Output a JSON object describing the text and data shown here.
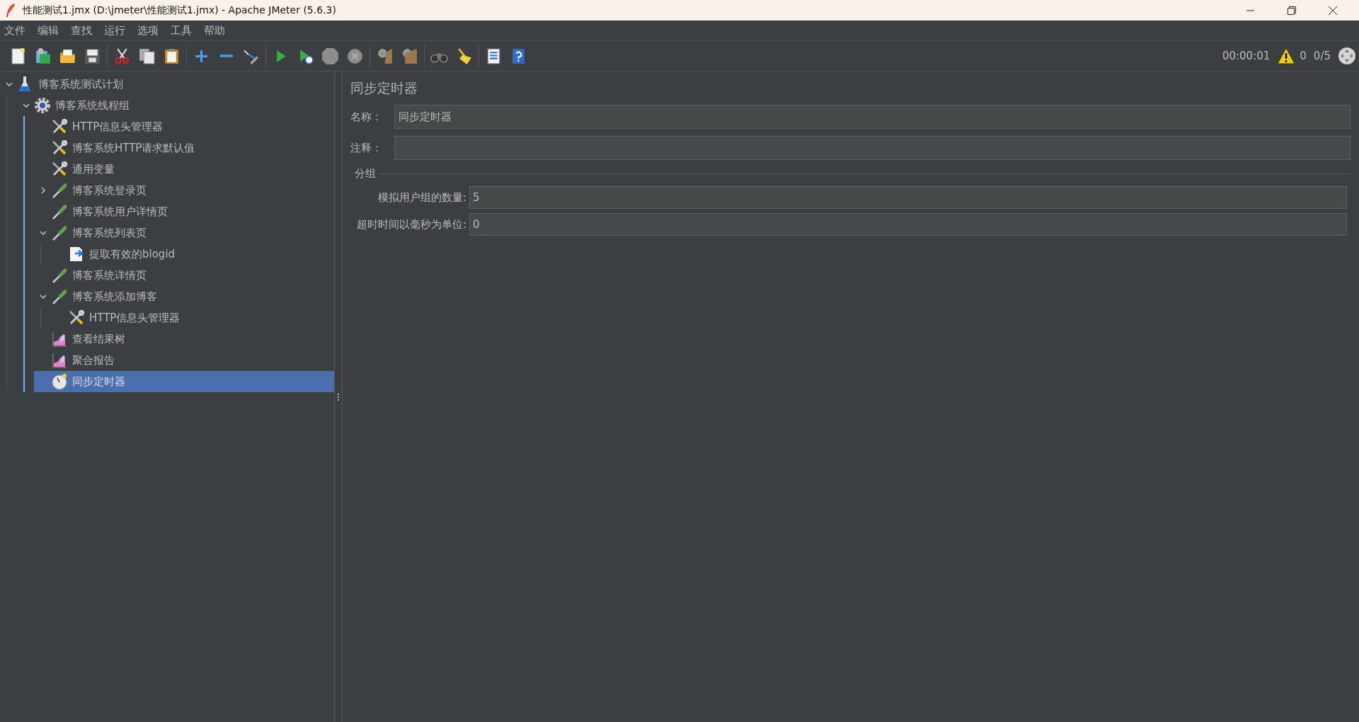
{
  "window": {
    "title": "性能测试1.jmx (D:\\jmeter\\性能测试1.jmx) - Apache JMeter (5.6.3)"
  },
  "menu": [
    "文件",
    "编辑",
    "查找",
    "运行",
    "选项",
    "工具",
    "帮助"
  ],
  "status": {
    "elapsed": "00:00:01",
    "warnings": "0",
    "threads": "0/5"
  },
  "tree": [
    {
      "label": "博客系统测试计划",
      "kind": "test-plan",
      "expanded": true,
      "selected": false,
      "children": [
        {
          "label": "博客系统线程组",
          "kind": "thread-group",
          "expanded": true,
          "selected": false,
          "children": [
            {
              "label": "HTTP信息头管理器",
              "kind": "config",
              "selected": false
            },
            {
              "label": "博客系统HTTP请求默认值",
              "kind": "config",
              "selected": false
            },
            {
              "label": "通用变量",
              "kind": "config",
              "selected": false
            },
            {
              "label": "博客系统登录页",
              "kind": "sampler",
              "expanded": false,
              "selected": false
            },
            {
              "label": "博客系统用户详情页",
              "kind": "sampler",
              "selected": false
            },
            {
              "label": "博客系统列表页",
              "kind": "sampler",
              "expanded": true,
              "selected": false,
              "children": [
                {
                  "label": "提取有效的blogid",
                  "kind": "extractor",
                  "selected": false
                }
              ]
            },
            {
              "label": "博客系统详情页",
              "kind": "sampler",
              "selected": false
            },
            {
              "label": "博客系统添加博客",
              "kind": "sampler",
              "expanded": true,
              "selected": false,
              "children": [
                {
                  "label": "HTTP信息头管理器",
                  "kind": "config",
                  "selected": false
                }
              ]
            },
            {
              "label": "查看结果树",
              "kind": "listener",
              "selected": false
            },
            {
              "label": "聚合报告",
              "kind": "listener",
              "selected": false
            },
            {
              "label": "同步定时器",
              "kind": "timer",
              "selected": true
            }
          ]
        }
      ]
    }
  ],
  "editor": {
    "title": "同步定时器",
    "name_label": "名称：",
    "name_value": "同步定时器",
    "comment_label": "注释：",
    "group_title": "分组",
    "fields": [
      {
        "label": "模拟用户组的数量:",
        "value": "5"
      },
      {
        "label": "超时时间以毫秒为单位:",
        "value": "0"
      }
    ]
  }
}
